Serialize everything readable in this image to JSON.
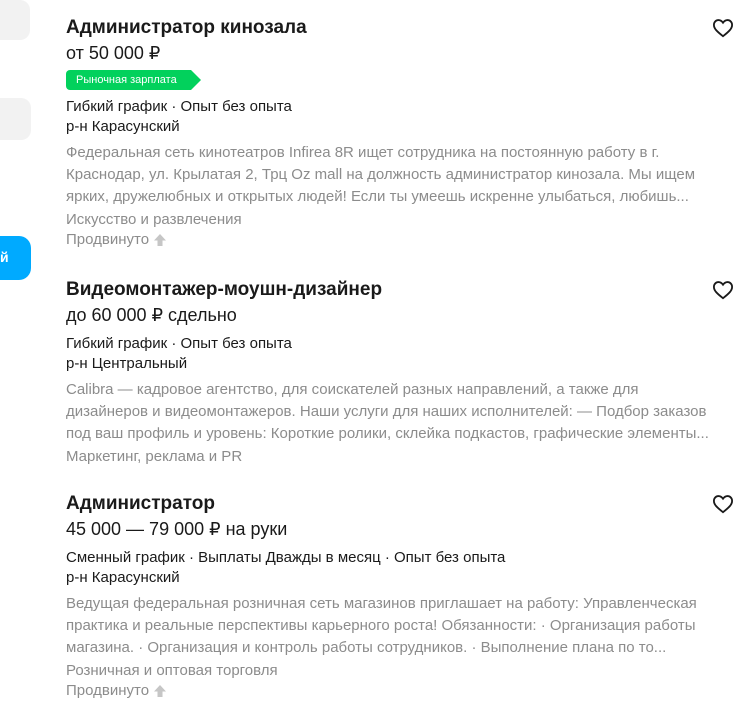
{
  "sidebar": {
    "active_item_label": "й"
  },
  "vacancies": [
    {
      "title": "Администратор кинозала",
      "salary": "от 50 000 ₽",
      "badge": "Рыночная зарплата",
      "schedule": "Гибкий график · Опыт без опыта",
      "district": "р-н Карасунский",
      "description_lines": [
        "Федеральная сеть кинотеатров Infirea 8R ищет сотрудника на постоянную работу в г.",
        "Краснодар, ул. Крылатая 2, Трц Oz mall на должность администратор кинозала. Мы ищем",
        "ярких, дружелюбных и открытых людей! Если ты умеешь искренне улыбаться, любишь..."
      ],
      "category": "Искусство и развлечения",
      "promoted": "Продвинуто"
    },
    {
      "title": "Видеомонтажер-моушн-дизайнер",
      "salary": "до 60 000 ₽ сдельно",
      "schedule": "Гибкий график · Опыт без опыта",
      "district": "р-н Центральный",
      "description_lines": [
        "Calibra — кадровое агентство, для соискателей разных направлений, а также для",
        "дизайнеров и видеомонтажеров. Наши услуги для наших исполнителей: — Подбор заказов",
        "под ваш профиль и уровень: Короткие ролики, склейка подкастов, графические элементы..."
      ],
      "category": "Маркетинг, реклама и PR"
    },
    {
      "title": "Администратор",
      "salary": "45 000 — 79 000 ₽ на руки",
      "schedule": "Сменный график · Выплаты Дважды в месяц · Опыт без опыта",
      "district": "р-н Карасунский",
      "description_lines": [
        "Ведущая федеральная розничная сеть магазинов приглашает на работу: Управленческая",
        "практика и реальные перспективы карьерного роста! Обязанности: · Организация работы",
        "магазина. · Организация и контроль работы сотрудников. · Выполнение плана по то..."
      ],
      "category": "Розничная и оптовая торговля",
      "promoted": "Продвинуто"
    }
  ],
  "colors": {
    "badge_green": "#02d15c",
    "accent_blue": "#00aaff",
    "muted_text": "#8c8c8c"
  },
  "icons": {
    "favorite": "heart-outline-icon",
    "promoted": "arrow-up-icon"
  }
}
